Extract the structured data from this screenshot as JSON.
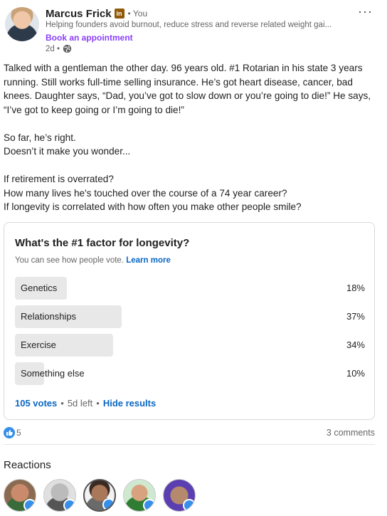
{
  "post": {
    "author": "Marcus Frick",
    "you_label": "• You",
    "headline": "Helping founders avoid burnout, reduce stress and reverse related weight gai...",
    "cta": "Book an appointment",
    "time": "2d •",
    "more": "···",
    "body": {
      "p1": "Talked with a gentleman the other day. 96 years old. #1 Rotarian in his state 3 years running. Still works full-time selling insurance. He’s got heart disease, cancer, bad knees. Daughter says, “Dad, you’ve got to slow down or you’re going to die!” He says, “I’ve got to keep going or I’m going to die!”",
      "p2": "So far, he’s right.",
      "p3": "Doesn’t it make you wonder...",
      "p4": "If retirement is overrated?",
      "p5": "How many lives he's touched over the course of a 74 year career?",
      "p6": "If longevity is correlated with how often you make other people smile?"
    }
  },
  "poll": {
    "question": "What's the #1 factor for longevity?",
    "visibility": "You can see how people vote.",
    "learn_more": "Learn more",
    "options": [
      {
        "label": "Genetics",
        "percent_label": "18%",
        "percent": 18
      },
      {
        "label": "Relationships",
        "percent_label": "37%",
        "percent": 37
      },
      {
        "label": "Exercise",
        "percent_label": "34%",
        "percent": 34
      },
      {
        "label": "Something else",
        "percent_label": "10%",
        "percent": 10
      }
    ],
    "votes": "105 votes",
    "time_left": "5d left",
    "hide_results": "Hide results"
  },
  "social": {
    "like_count": "5",
    "comments": "3 comments"
  },
  "reactions": {
    "title": "Reactions"
  },
  "colors": {
    "accent_blue": "#0a66c2",
    "cta_purple": "#8a3ffc",
    "premium_gold": "#915907",
    "like_blue": "#378fe9"
  }
}
